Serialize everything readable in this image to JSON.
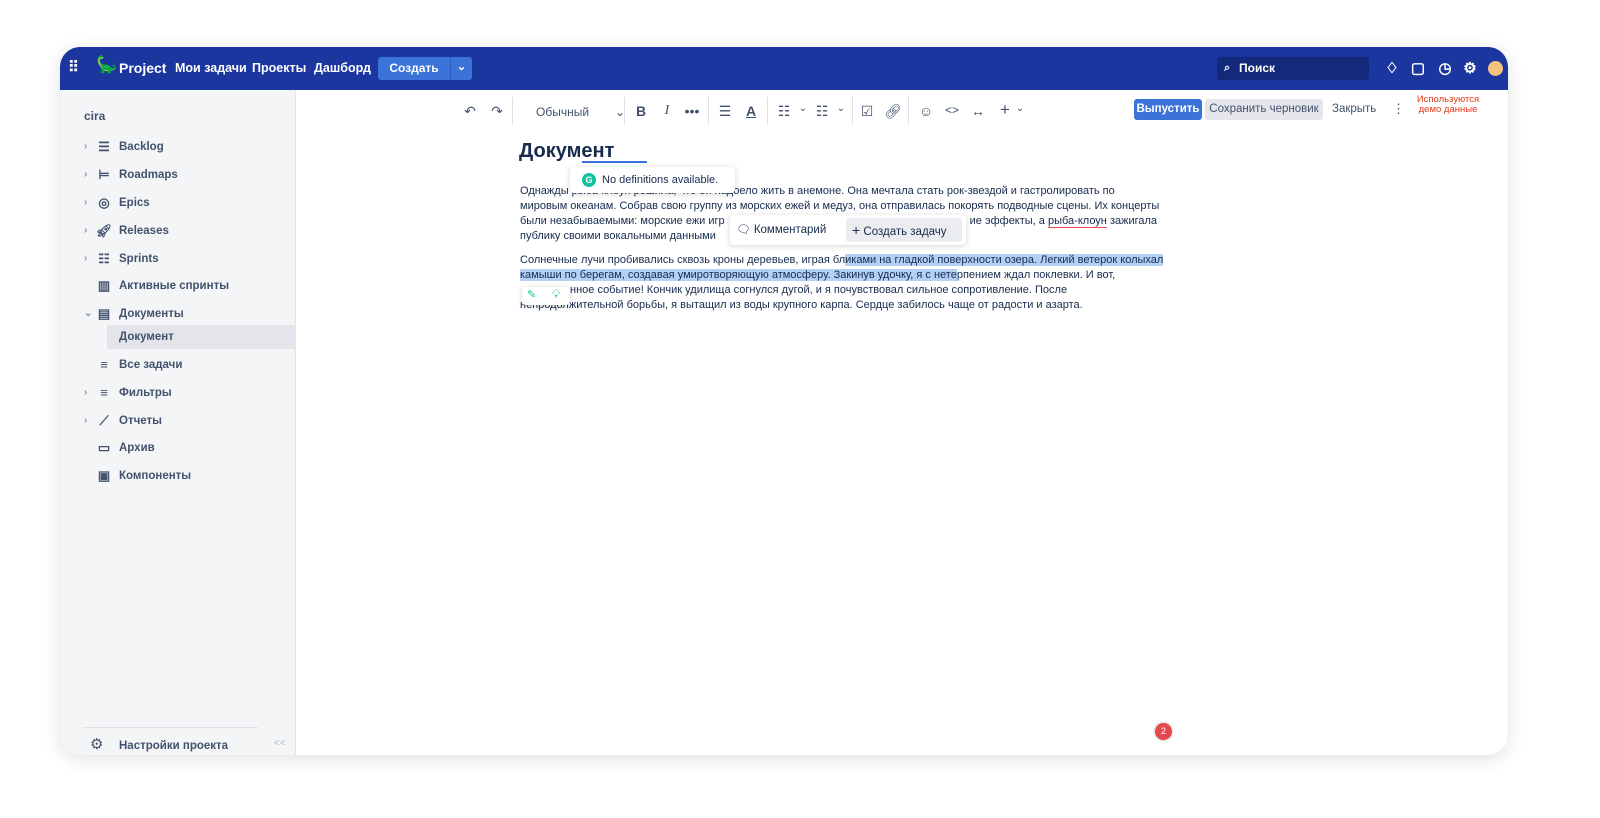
{
  "header": {
    "app_name": "Project",
    "nav": [
      "Мои задачи",
      "Проекты",
      "Дашборд"
    ],
    "create_label": "Создать",
    "search_placeholder": "Поиск",
    "brand_color": "#1b369f"
  },
  "sidebar": {
    "project": "cira",
    "items": [
      {
        "label": "Backlog",
        "icon": "backlog-icon",
        "chevron": "›"
      },
      {
        "label": "Roadmaps",
        "icon": "roadmap-icon",
        "chevron": "›"
      },
      {
        "label": "Epics",
        "icon": "target-icon",
        "chevron": "›"
      },
      {
        "label": "Releases",
        "icon": "rocket-icon",
        "chevron": "›"
      },
      {
        "label": "Sprints",
        "icon": "checklist-icon",
        "chevron": "›"
      },
      {
        "label": "Активные спринты",
        "icon": "board-icon",
        "chevron": ""
      },
      {
        "label": "Документы",
        "icon": "document-icon",
        "chevron": "⌄"
      },
      {
        "label": "Документ",
        "icon": "",
        "chevron": ""
      },
      {
        "label": "Все задачи",
        "icon": "filter-icon",
        "chevron": ""
      },
      {
        "label": "Фильтры",
        "icon": "filter-icon",
        "chevron": "›"
      },
      {
        "label": "Отчеты",
        "icon": "chart-icon",
        "chevron": "›"
      },
      {
        "label": "Архив",
        "icon": "archive-icon",
        "chevron": ""
      },
      {
        "label": "Компоненты",
        "icon": "components-icon",
        "chevron": ""
      }
    ],
    "settings_label": "Настройки проекта",
    "collapse": "<<"
  },
  "toolbar": {
    "style_select": "Обычный",
    "publish": "Выпустить",
    "save_draft": "Сохранить черновик",
    "close": "Закрыть",
    "demo_notice_1": "Используются",
    "demo_notice_2": "демо данные",
    "demo_color": "#e5391a"
  },
  "document": {
    "title": "Документ",
    "p1": [
      "Однажды рыба-клоун решила, что ей надоело жить в анемоне. Она мечтала стать рок-звездой и гастролировать по",
      "мировым океанам. Собрав свою группу из морских ежей и медуз, она отправилась покорять подводные сцены. Их концерты",
      "были незабываемыми: морские ежи игр",
      "ие эффекты, а ",
      "рыба-клоун",
      " зажигала",
      "публику своими вокальными данными"
    ],
    "p2": [
      "Солнечные лучи пробивались сквозь кроны деревьев, играя бл",
      "иками на гладкой поверхности озера. Легкий ветерок колыхал",
      "камыши по берегам, создавая умиротворяющую атмосферу. Закинув удочку, я с нете",
      "рпением ждал поклевки. И вот,",
      "нное событие! Кончик удилища согнулся дугой, и я почувствовал сильное сопротивление. После",
      "непродолжительной борьбы, я вытащил из воды крупного карпа. Сердце забилось чаще от радости и азарта."
    ]
  },
  "popups": {
    "definition": "No definitions available.",
    "comment": "Комментарий",
    "create_task": "Создать задачу"
  }
}
